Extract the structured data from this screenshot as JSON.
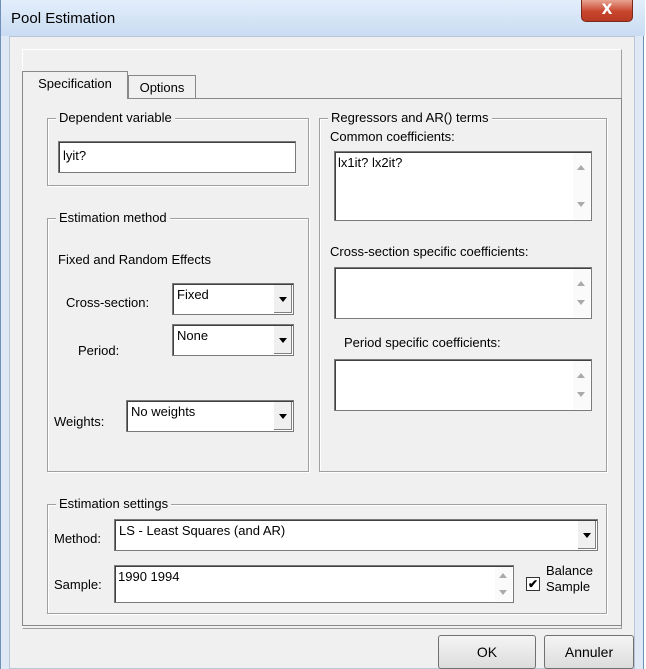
{
  "window": {
    "title": "Pool Estimation",
    "close_glyph": "X"
  },
  "tabs": [
    {
      "label": "Specification"
    },
    {
      "label": "Options"
    }
  ],
  "dependent": {
    "label": "Dependent variable",
    "value": "lyit?"
  },
  "estimation_method": {
    "label": "Estimation method",
    "effects_label": "Fixed and Random Effects",
    "cross_section_label": "Cross-section:",
    "cross_section_value": "Fixed",
    "period_label": "Period:",
    "period_value": "None",
    "weights_label": "Weights:",
    "weights_value": "No weights"
  },
  "regressors": {
    "label": "Regressors and AR() terms",
    "common_label": "Common coefficients:",
    "common_value": "lx1it? lx2it?",
    "cross_label": "Cross-section specific coefficients:",
    "cross_value": "",
    "period_label": "Period specific coefficients:",
    "period_value": ""
  },
  "settings": {
    "label": "Estimation settings",
    "method_label": "Method:",
    "method_value": "LS  -  Least Squares (and AR)",
    "sample_label": "Sample:",
    "sample_value": "1990 1994",
    "balance_label_1": "Balance",
    "balance_label_2": "Sample",
    "balance_checked": true,
    "check_glyph": "✔"
  },
  "buttons": {
    "ok": "OK",
    "cancel": "Annuler"
  }
}
